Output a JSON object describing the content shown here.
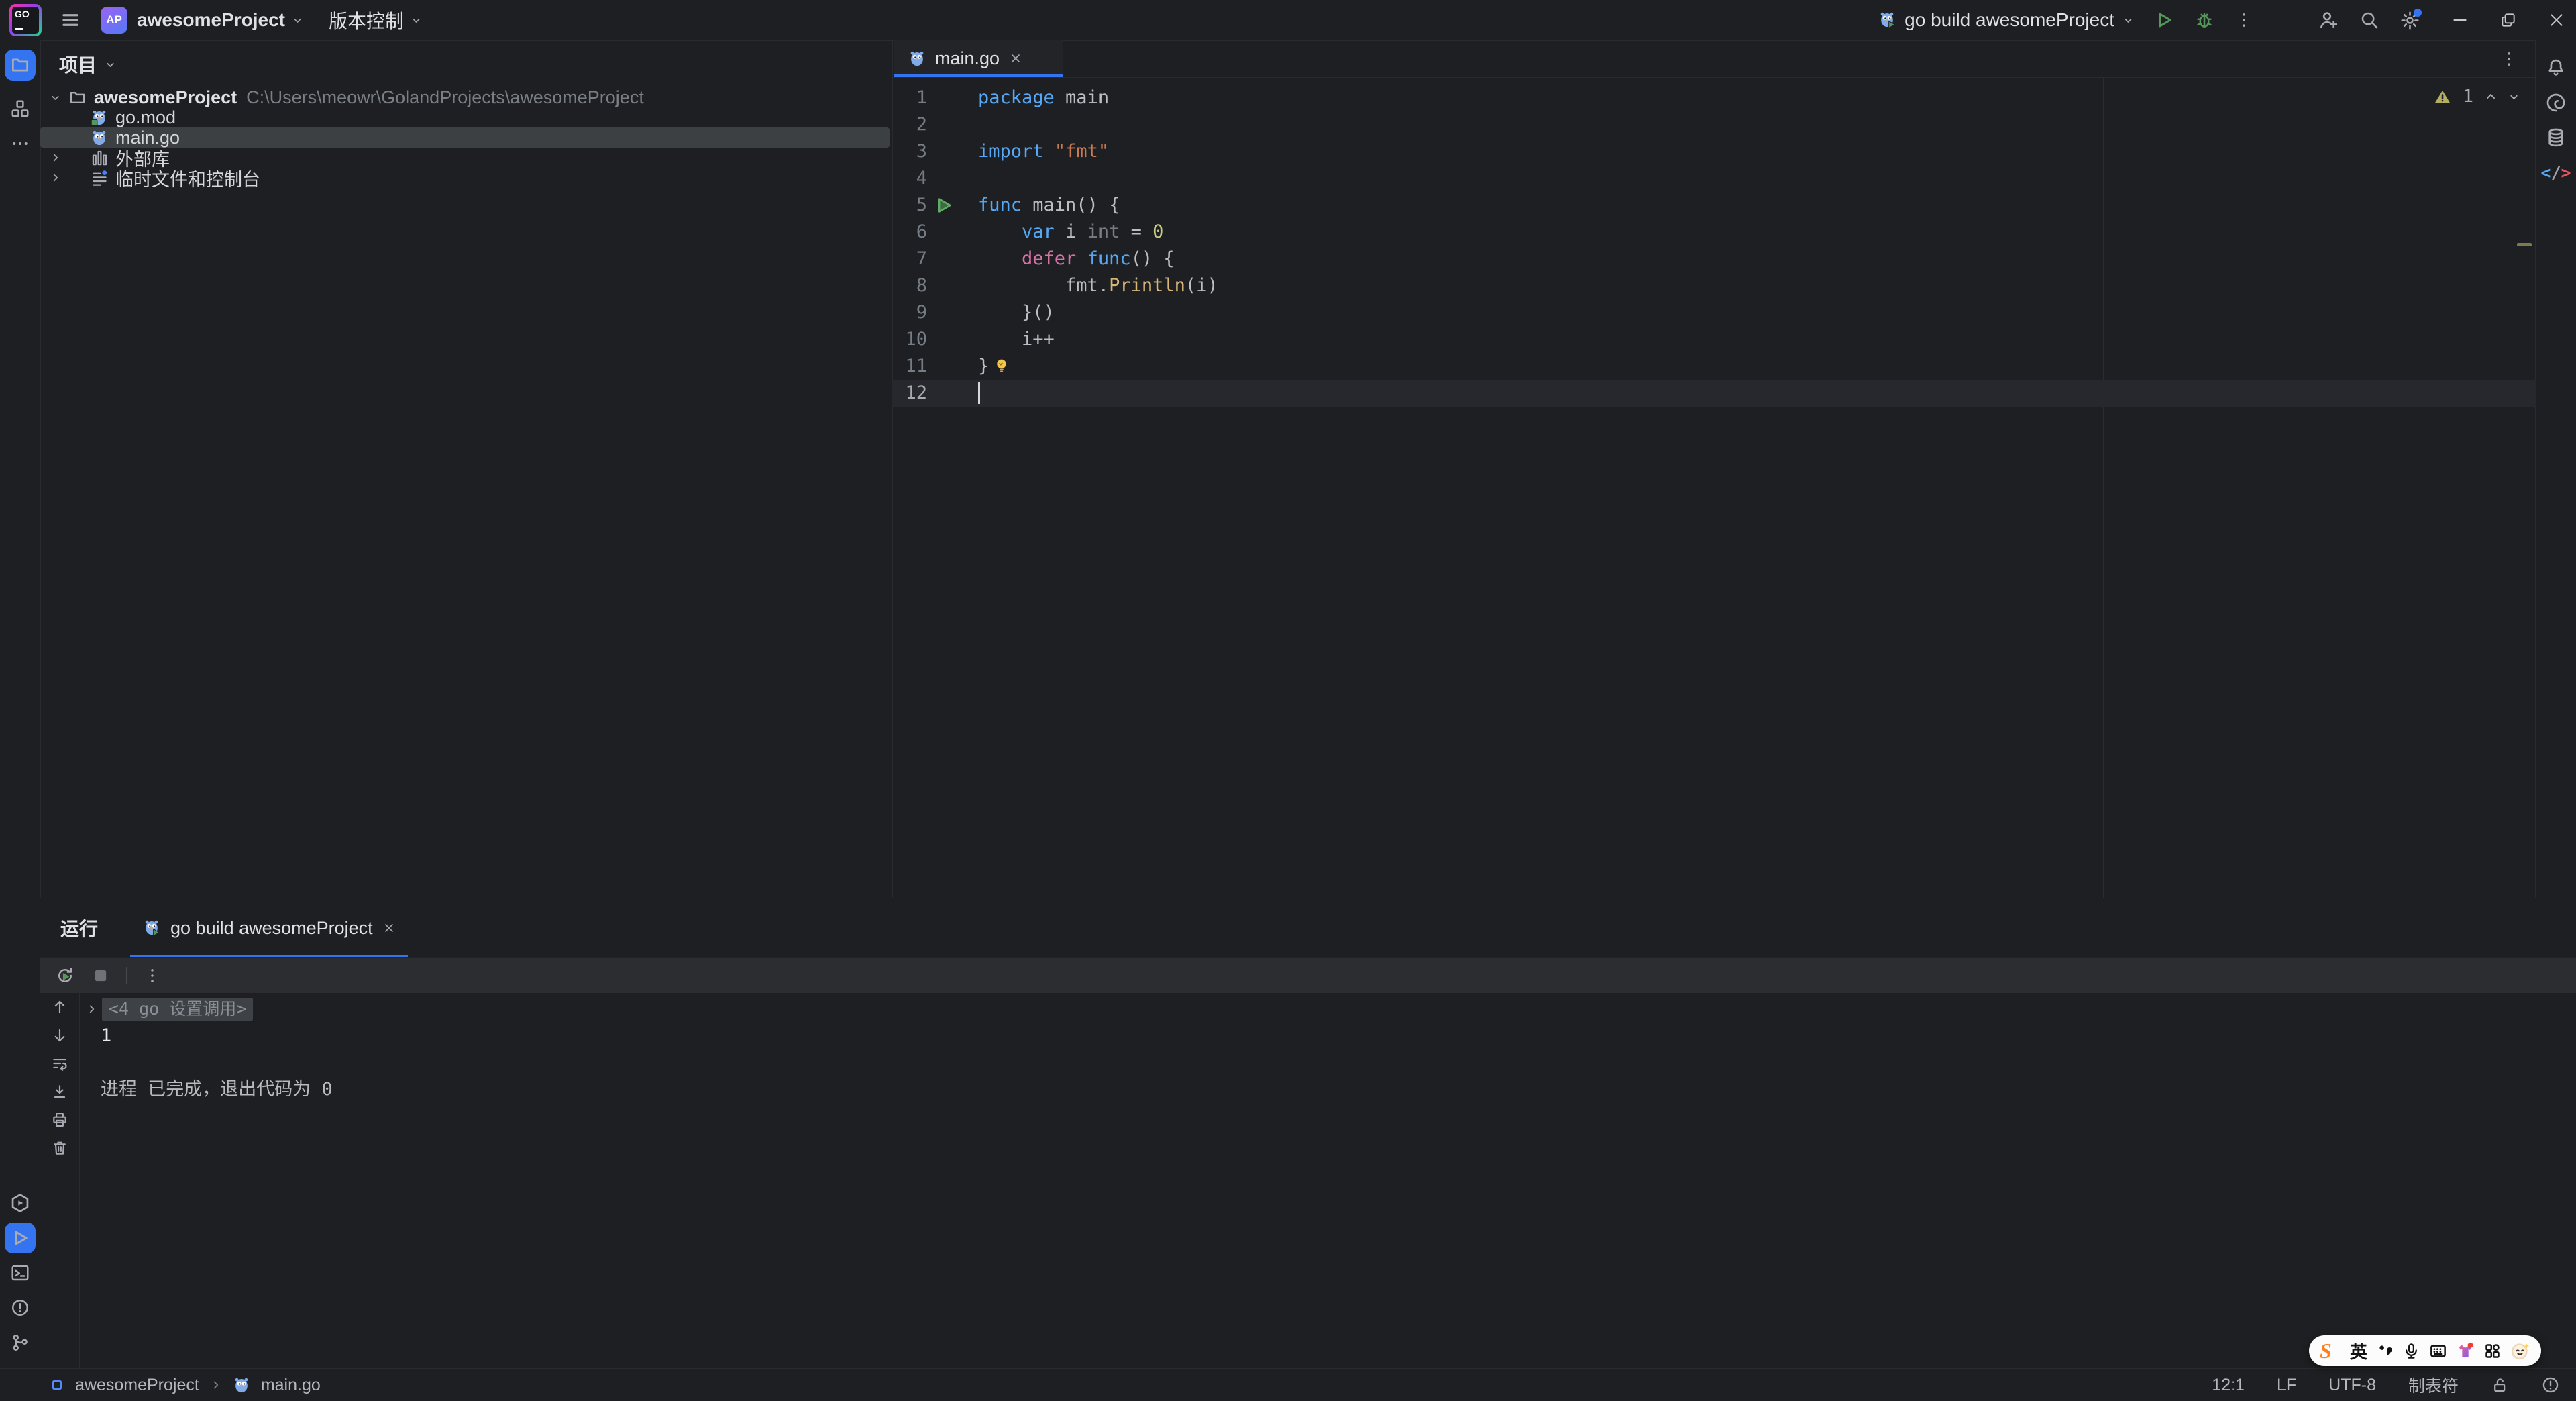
{
  "colors": {
    "accent_blue": "#3574F0",
    "keyword": "#56A8F5",
    "keyword_secondary": "#D773A8",
    "string": "#C87A50",
    "number": "#C9CB83",
    "function_call": "#D5B778",
    "type_hint": "#787C82",
    "run_green": "#57965C",
    "warning_olive": "#B3AE60",
    "selection_bg": "#3D4043",
    "panel_bg": "#1E1F22"
  },
  "title_bar": {
    "logo_text": "GO",
    "project_badge": "AP",
    "project_name": "awesomeProject",
    "vcs_label": "版本控制",
    "run_config_label": "go build awesomeProject"
  },
  "tool_stripes": {
    "left_top": [
      {
        "icon": "folder",
        "name": "project",
        "active": true
      },
      {
        "divider": true
      },
      {
        "icon": "structure",
        "name": "structure"
      },
      {
        "icon": "more-horizontal",
        "name": "more-tool-windows"
      }
    ],
    "left_bottom": [
      {
        "icon": "services",
        "name": "services"
      },
      {
        "icon": "play",
        "name": "run",
        "active": true
      },
      {
        "icon": "terminal",
        "name": "terminal"
      },
      {
        "icon": "problems",
        "name": "problems"
      },
      {
        "icon": "git-branch",
        "name": "version-control"
      }
    ],
    "right": [
      {
        "icon": "bell",
        "name": "notifications"
      },
      {
        "icon": "ai-swirl",
        "name": "ai-assistant"
      },
      {
        "icon": "database",
        "name": "database"
      },
      {
        "icon": "markup",
        "name": "markup"
      }
    ]
  },
  "project_panel": {
    "header": "项目",
    "tree": [
      {
        "name": "awesomeProject",
        "path": "C:\\Users\\meowr\\GolandProjects\\awesomeProject",
        "icon": "folder-node",
        "chevron": "down",
        "bold": true,
        "kind": "root"
      },
      {
        "name": "go.mod",
        "icon": "go-mod",
        "kind": "file"
      },
      {
        "name": "main.go",
        "icon": "gopher",
        "kind": "file",
        "selected": true
      },
      {
        "name": "外部库",
        "icon": "library",
        "chevron": "right",
        "kind": "section"
      },
      {
        "name": "临时文件和控制台",
        "icon": "scratches",
        "chevron": "right",
        "kind": "section"
      }
    ]
  },
  "editor": {
    "tab_label": "main.go",
    "warning_count": "1",
    "lines": [
      {
        "n": "1",
        "tokens": [
          [
            "package",
            "kw"
          ],
          [
            " main",
            "tx"
          ]
        ]
      },
      {
        "n": "2",
        "tokens": []
      },
      {
        "n": "3",
        "tokens": [
          [
            "import",
            "kw"
          ],
          [
            " ",
            "tx"
          ],
          [
            "\"fmt\"",
            "str"
          ]
        ]
      },
      {
        "n": "4",
        "tokens": []
      },
      {
        "n": "5",
        "gutter": "run",
        "tokens": [
          [
            "func",
            "kw"
          ],
          [
            " main() {",
            "tx"
          ]
        ]
      },
      {
        "n": "6",
        "tokens": [
          [
            "    ",
            "tx"
          ],
          [
            "var",
            "kw"
          ],
          [
            " i ",
            "tx"
          ],
          [
            "int",
            "hint"
          ],
          [
            " = ",
            "tx"
          ],
          [
            "0",
            "num"
          ]
        ]
      },
      {
        "n": "7",
        "tokens": [
          [
            "    ",
            "tx"
          ],
          [
            "defer",
            "kw2"
          ],
          [
            " ",
            "tx"
          ],
          [
            "func",
            "kw"
          ],
          [
            "() {",
            "tx"
          ]
        ]
      },
      {
        "n": "8",
        "guide": true,
        "tokens": [
          [
            "        fmt.",
            "tx"
          ],
          [
            "Println",
            "fn"
          ],
          [
            "(i)",
            "tx"
          ]
        ]
      },
      {
        "n": "9",
        "tokens": [
          [
            "    }()",
            "tx"
          ]
        ]
      },
      {
        "n": "10",
        "tokens": [
          [
            "    i++",
            "tx"
          ]
        ]
      },
      {
        "n": "11",
        "bulb": true,
        "tokens": [
          [
            "}",
            "tx"
          ]
        ]
      },
      {
        "n": "12",
        "current": true,
        "caret": true,
        "tokens": []
      }
    ]
  },
  "run_panel": {
    "title": "运行",
    "tab_label": "go build awesomeProject",
    "console": [
      {
        "type": "fold",
        "text": "<4 go 设置调用>"
      },
      {
        "type": "stdout",
        "text": "1"
      },
      {
        "type": "blank",
        "text": ""
      },
      {
        "type": "system",
        "text": "进程 已完成，退出代码为 0"
      }
    ]
  },
  "status_bar": {
    "project": "awesomeProject",
    "file": "main.go",
    "caret_position": "12:1",
    "line_separator": "LF",
    "encoding": "UTF-8",
    "indent_style": "制表符"
  },
  "ime_bar": {
    "brand": "S",
    "mode_label": "英"
  }
}
